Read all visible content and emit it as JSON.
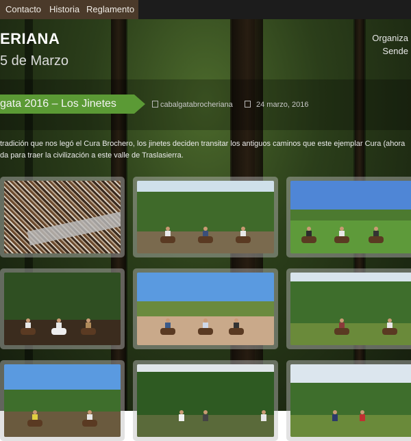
{
  "nav": {
    "items": [
      "Contacto",
      "Historia",
      "Reglamento"
    ]
  },
  "site": {
    "title": "ERIANA",
    "subtitle": "5 de Marzo",
    "organizer_line1": "Organiza",
    "organizer_line2": "Sende"
  },
  "post": {
    "title": "gata 2016 – Los Jinetes",
    "author": "cabalgatabrocheriana",
    "date": "24 marzo, 2016",
    "intro_line1": "tradición que nos legó el Cura Brochero, los jinetes deciden transitar los antiguos caminos que este ejemplar Cura (ahora",
    "intro_line2": "da para traer la civilización a este valle de Traslasierra."
  },
  "gallery": {
    "photos": [
      {
        "alt": "crowd-aerial"
      },
      {
        "alt": "riders-forest-road"
      },
      {
        "alt": "riders-field"
      },
      {
        "alt": "riders-woods"
      },
      {
        "alt": "riders-dirt-road"
      },
      {
        "alt": "riders-hillside"
      },
      {
        "alt": "riders-flags"
      },
      {
        "alt": "riders-pines"
      },
      {
        "alt": "riders-poles"
      }
    ]
  },
  "colors": {
    "nav_bg": "#1c1c1c",
    "nav_active": "#4b3a2a",
    "badge": "#5b9a35"
  }
}
